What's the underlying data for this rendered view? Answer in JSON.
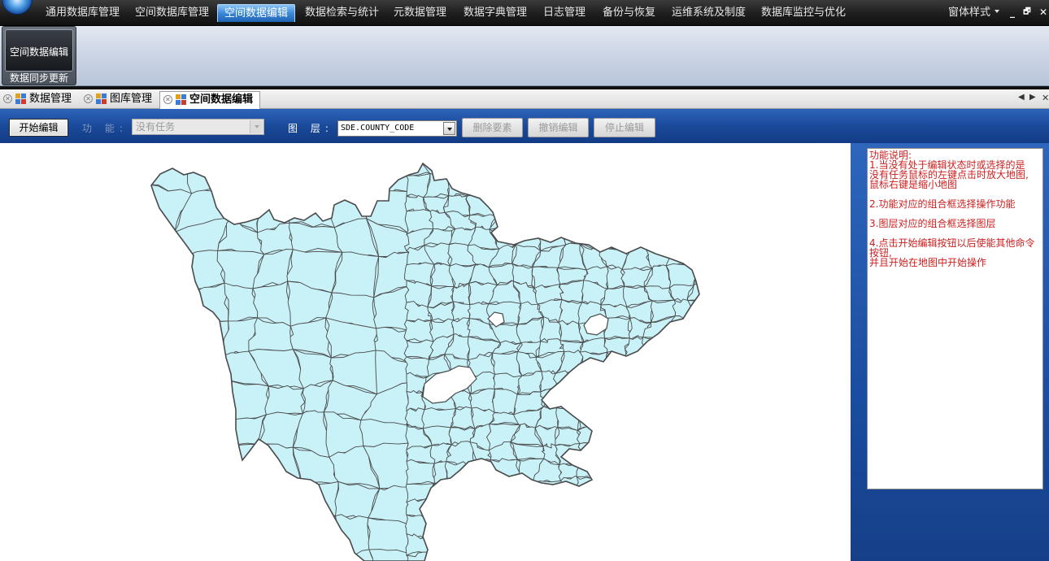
{
  "menubar": {
    "items": [
      "通用数据库管理",
      "空间数据库管理",
      "空间数据编辑",
      "数据检索与统计",
      "元数据管理",
      "数据字典管理",
      "日志管理",
      "备份与恢复",
      "运维系统及制度",
      "数据库监控与优化"
    ],
    "active_index": 2,
    "theme_menu": "窗体样式",
    "window_buttons": [
      "_",
      "🗗",
      "✕"
    ]
  },
  "ribbon": {
    "big_button": "空间数据编辑",
    "group_caption": "数据同步更新"
  },
  "tabs": [
    {
      "label": "数据管理"
    },
    {
      "label": "图库管理"
    },
    {
      "label": "空间数据编辑"
    }
  ],
  "tab_nav": [
    "◀",
    "▶",
    "✕"
  ],
  "toolbar": {
    "start_edit": "开始编辑",
    "function_label": "功 能:",
    "function_value": "没有任务",
    "layer_label": "图 层:",
    "layer_value": "SDE.COUNTY_CODE",
    "delete_feature": "删除要素",
    "undo_edit": "撤销编辑",
    "stop_edit": "停止编辑"
  },
  "help": {
    "title": "功能说明:",
    "lines": [
      "1.当没有处于编辑状态时或选择的是",
      "没有任务鼠标的左键点击时放大地图,",
      "鼠标右键是缩小地图",
      "",
      "2.功能对应的组合框选择操作功能",
      "",
      "3.图层对应的组合框选择图层",
      "",
      "4.点击开始编辑按钮以后使能其他命令",
      "按钮,",
      "并且开始在地图中开始操作"
    ]
  },
  "map": {
    "fill_color": "#c8f1f8",
    "boundary_color": "#4a4a4a"
  }
}
